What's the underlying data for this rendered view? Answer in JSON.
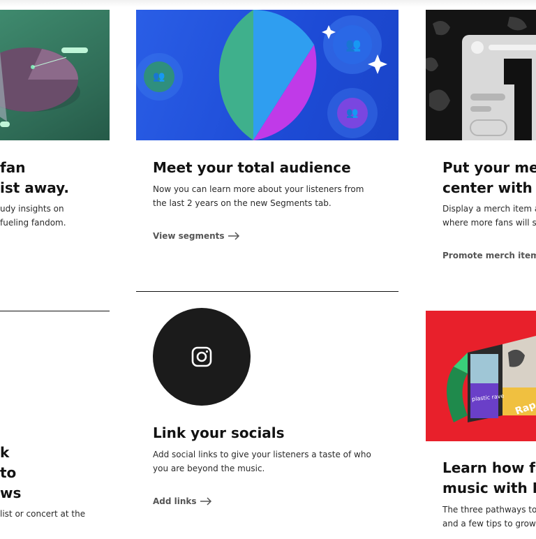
{
  "cards": {
    "c1": {
      "title_lines": [
        "fan",
        "ist away."
      ],
      "desc_lines": [
        "udy insights on",
        "fueling fandom."
      ]
    },
    "c2": {
      "title": "Meet your total audience",
      "desc_lines": [
        "Now you can learn more about your listeners from",
        "the last 2 years on the new Segments tab."
      ],
      "link": "View segments"
    },
    "c3": {
      "title_lines": [
        "Put your mer",
        "center with A"
      ],
      "desc_lines": [
        "Display a merch item a",
        "where more fans will s"
      ],
      "link": "Promote merch item"
    },
    "c4": {
      "title_lines": [
        "k",
        "to",
        "ws"
      ],
      "desc_lines": [
        "list or concert at the"
      ]
    },
    "c5": {
      "title": "Link your socials",
      "desc_lines": [
        "Add social links to give your listeners a taste of who",
        "you are beyond the music."
      ],
      "link": "Add links"
    },
    "c6": {
      "title_lines": [
        "Learn how fa",
        "music with M"
      ],
      "desc_lines": [
        "The three pathways to",
        "and a few tips to grow"
      ],
      "tile_texts": [
        "plastic rave",
        "Rap"
      ]
    }
  },
  "icons": {
    "arrow": "arrow-right-icon",
    "instagram": "instagram-icon",
    "audience": "people-icon",
    "sparkle": "sparkle-icon"
  },
  "colors": {
    "card2_bg": "#1f52e0",
    "card5_circle": "#1b1b1b",
    "card6_bg": "#e8202b",
    "pie_purple": "#c03ae8",
    "pie_teal": "#3fb08c"
  }
}
